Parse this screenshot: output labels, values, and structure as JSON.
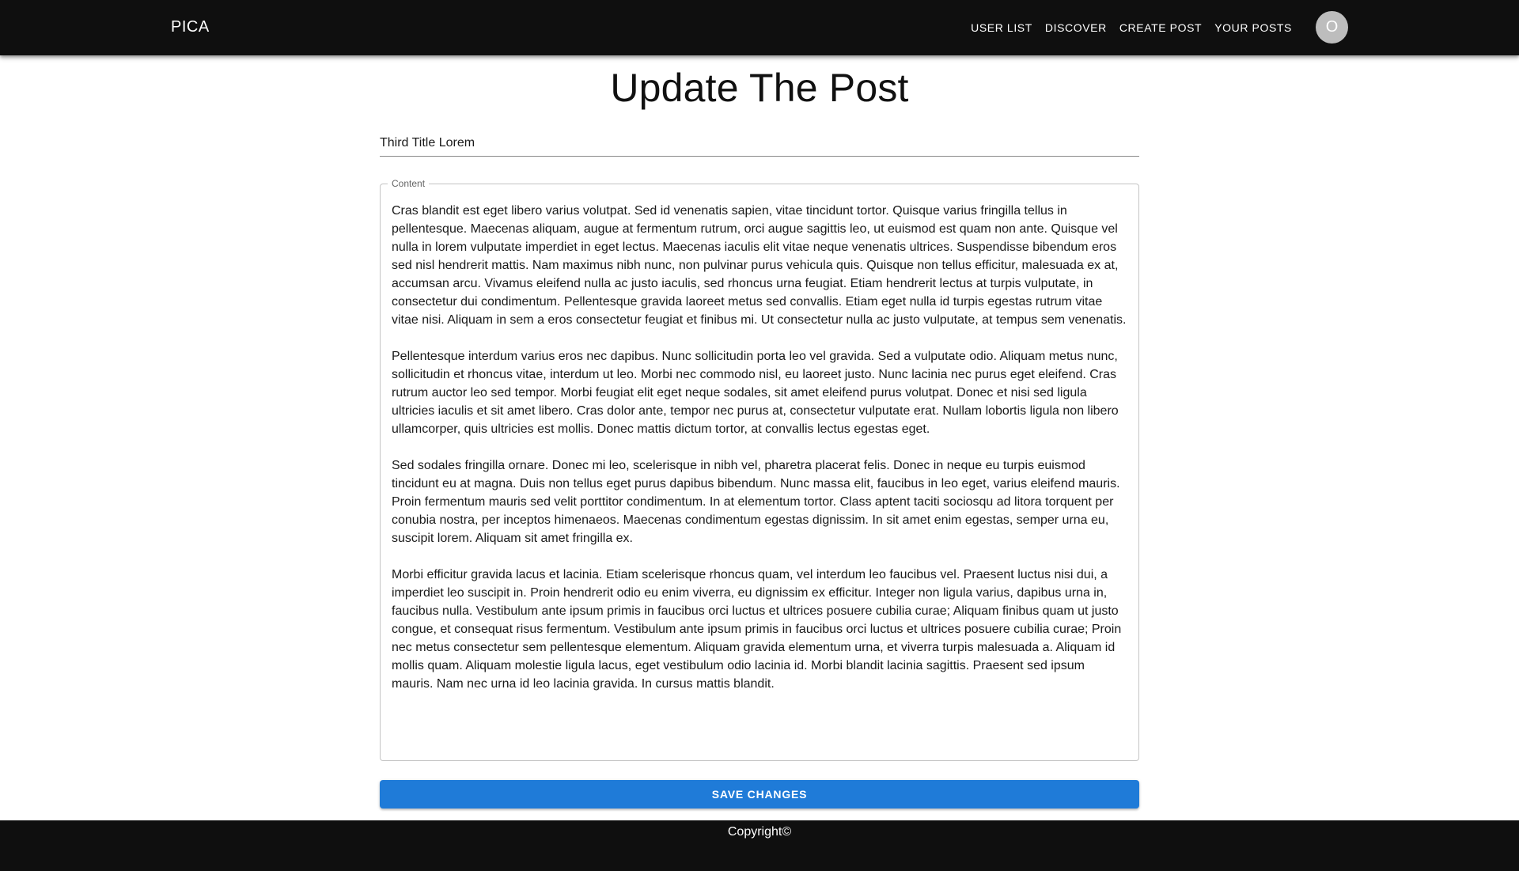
{
  "header": {
    "brand": "PICA",
    "nav": [
      {
        "label": "USER LIST"
      },
      {
        "label": "DISCOVER"
      },
      {
        "label": "CREATE POST"
      },
      {
        "label": "YOUR POSTS"
      }
    ],
    "avatar_initial": "O"
  },
  "main": {
    "page_title": "Update The Post",
    "title_field": {
      "value": "Third Title Lorem"
    },
    "content_field": {
      "label": "Content",
      "value": "Cras blandit est eget libero varius volutpat. Sed id venenatis sapien, vitae tincidunt tortor. Quisque varius fringilla tellus in pellentesque. Maecenas aliquam, augue at fermentum rutrum, orci augue sagittis leo, ut euismod est quam non ante. Quisque vel nulla in lorem vulputate imperdiet in eget lectus. Maecenas iaculis elit vitae neque venenatis ultrices. Suspendisse bibendum eros sed nisl hendrerit mattis. Nam maximus nibh nunc, non pulvinar purus vehicula quis. Quisque non tellus efficitur, malesuada ex at, accumsan arcu. Vivamus eleifend nulla ac justo iaculis, sed rhoncus urna feugiat. Etiam hendrerit lectus at turpis vulputate, in consectetur dui condimentum. Pellentesque gravida laoreet metus sed convallis. Etiam eget nulla id turpis egestas rutrum vitae vitae nisi. Aliquam in sem a eros consectetur feugiat et finibus mi. Ut consectetur nulla ac justo vulputate, at tempus sem venenatis.\n\nPellentesque interdum varius eros nec dapibus. Nunc sollicitudin porta leo vel gravida. Sed a vulputate odio. Aliquam metus nunc, sollicitudin et rhoncus vitae, interdum ut leo. Morbi nec commodo nisl, eu laoreet justo. Nunc lacinia nec purus eget eleifend. Cras rutrum auctor leo sed tempor. Morbi feugiat elit eget neque sodales, sit amet eleifend purus volutpat. Donec et nisi sed ligula ultricies iaculis et sit amet libero. Cras dolor ante, tempor nec purus at, consectetur vulputate erat. Nullam lobortis ligula non libero ullamcorper, quis ultricies est mollis. Donec mattis dictum tortor, at convallis lectus egestas eget.\n\nSed sodales fringilla ornare. Donec mi leo, scelerisque in nibh vel, pharetra placerat felis. Donec in neque eu turpis euismod tincidunt eu at magna. Duis non tellus eget purus dapibus bibendum. Nunc massa elit, faucibus in leo eget, varius eleifend mauris. Proin fermentum mauris sed velit porttitor condimentum. In at elementum tortor. Class aptent taciti sociosqu ad litora torquent per conubia nostra, per inceptos himenaeos. Maecenas condimentum egestas dignissim. In sit amet enim egestas, semper urna eu, suscipit lorem. Aliquam sit amet fringilla ex.\n\nMorbi efficitur gravida lacus et lacinia. Etiam scelerisque rhoncus quam, vel interdum leo faucibus vel. Praesent luctus nisi dui, a imperdiet leo suscipit in. Proin hendrerit odio eu enim viverra, eu dignissim ex efficitur. Integer non ligula varius, dapibus urna in, faucibus nulla. Vestibulum ante ipsum primis in faucibus orci luctus et ultrices posuere cubilia curae; Aliquam finibus quam ut justo congue, et consequat risus fermentum. Vestibulum ante ipsum primis in faucibus orci luctus et ultrices posuere cubilia curae; Proin nec metus consectetur sem pellentesque elementum. Aliquam gravida elementum urna, et viverra turpis malesuada a. Aliquam id mollis quam. Aliquam molestie ligula lacus, eget vestibulum odio lacinia id. Morbi blandit lacinia sagittis. Praesent sed ipsum mauris. Nam nec urna id leo lacinia gravida. In cursus mattis blandit."
    },
    "save_label": "SAVE CHANGES"
  },
  "footer": {
    "copyright": "Copyright©"
  },
  "colors": {
    "appbar": "#0f0f0f",
    "primary": "#1f7bd8",
    "avatar": "#bdbdbd"
  }
}
